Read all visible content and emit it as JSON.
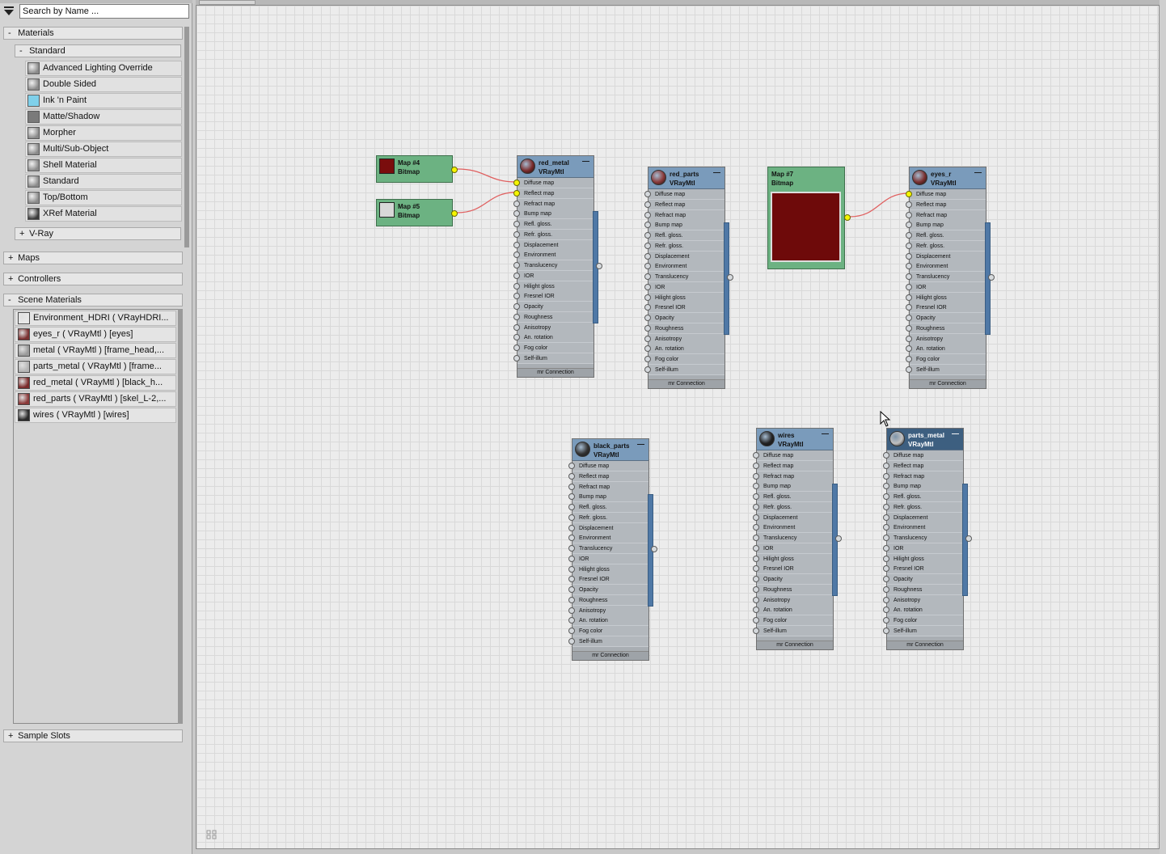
{
  "browser": {
    "search_placeholder": "Search by Name ...",
    "groups": {
      "materials": {
        "sign": "-",
        "label": "Materials"
      },
      "standard": {
        "sign": "-",
        "label": "Standard"
      },
      "vray": {
        "sign": "+",
        "label": "V-Ray"
      },
      "maps": {
        "sign": "+",
        "label": "Maps"
      },
      "controllers": {
        "sign": "+",
        "label": "Controllers"
      },
      "scene_materials": {
        "sign": "-",
        "label": "Scene Materials"
      },
      "sample_slots": {
        "sign": "+",
        "label": "Sample Slots"
      }
    },
    "standard_materials": [
      {
        "label": "Advanced Lighting Override",
        "swatch": "#8a8a8a"
      },
      {
        "label": "Double Sided",
        "swatch": "#8a8a8a"
      },
      {
        "label": "Ink 'n Paint",
        "swatch": "#7fd0ea"
      },
      {
        "label": "Matte/Shadow",
        "swatch": "#7a7a7a"
      },
      {
        "label": "Morpher",
        "swatch": "#8a8a8a"
      },
      {
        "label": "Multi/Sub-Object",
        "swatch": "#8a8a8a"
      },
      {
        "label": "Shell Material",
        "swatch": "#8a8a8a"
      },
      {
        "label": "Standard",
        "swatch": "#8a8a8a"
      },
      {
        "label": "Top/Bottom",
        "swatch": "#8a8a8a"
      },
      {
        "label": "XRef Material",
        "swatch": "#3a3a3a"
      }
    ],
    "scene_materials": [
      {
        "label": "Environment_HDRI  ( VRayHDRI...",
        "swatch": "#e8e8e8"
      },
      {
        "label": "eyes_r  ( VRayMtl ) [eyes]",
        "swatch": "#7a3030"
      },
      {
        "label": "metal  ( VRayMtl ) [frame_head,...",
        "swatch": "#9a9a9a"
      },
      {
        "label": "parts_metal  ( VRayMtl ) [frame...",
        "swatch": "#b5b5b5"
      },
      {
        "label": "red_metal  ( VRayMtl ) [black_h...",
        "swatch": "#7a2a2a"
      },
      {
        "label": "red_parts  ( VRayMtl ) [skel_L-2,...",
        "swatch": "#8a3a3a"
      },
      {
        "label": "wires  ( VRayMtl ) [wires]",
        "swatch": "#2a2a2a"
      }
    ]
  },
  "slots": [
    "Diffuse map",
    "Reflect map",
    "Refract map",
    "Bump map",
    "Refl. gloss.",
    "Refr. gloss.",
    "Displacement",
    "Environment",
    "Translucency",
    "IOR",
    "Hilight gloss",
    "Fresnel IOR",
    "Opacity",
    "Roughness",
    "Anisotropy",
    "An. rotation",
    "Fog color",
    "Self-illum"
  ],
  "footer_label": "mr Connection",
  "min_glyph": "—",
  "nodes": [
    {
      "name": "red_metal",
      "type": "VRayMtl",
      "thumb": "#7a2a2a",
      "lit_slots": [
        0,
        1
      ],
      "selected": false
    },
    {
      "name": "red_parts",
      "type": "VRayMtl",
      "thumb": "#8a3a3a",
      "lit_slots": [],
      "selected": false
    },
    {
      "name": "eyes_r",
      "type": "VRayMtl",
      "thumb": "#7a3030",
      "lit_slots": [
        0
      ],
      "selected": false
    },
    {
      "name": "black_parts",
      "type": "VRayMtl",
      "thumb": "#333333",
      "lit_slots": [],
      "selected": false
    },
    {
      "name": "wires",
      "type": "VRayMtl",
      "thumb": "#222222",
      "lit_slots": [],
      "selected": false
    },
    {
      "name": "parts_metal",
      "type": "VRayMtl",
      "thumb": "#c0c0c0",
      "lit_slots": [],
      "selected": true
    }
  ],
  "bitmaps": [
    {
      "name": "Map #4",
      "type": "Bitmap",
      "thumb": "#7a0d0d"
    },
    {
      "name": "Map #5",
      "type": "Bitmap",
      "thumb": "#d8d8d8"
    },
    {
      "name": "Map #7",
      "type": "Bitmap",
      "thumb": "#6e0a0a"
    }
  ],
  "colors": {
    "wire": "#e06060",
    "node_header": "#7a9bbb",
    "bitmap": "#6cb282"
  }
}
